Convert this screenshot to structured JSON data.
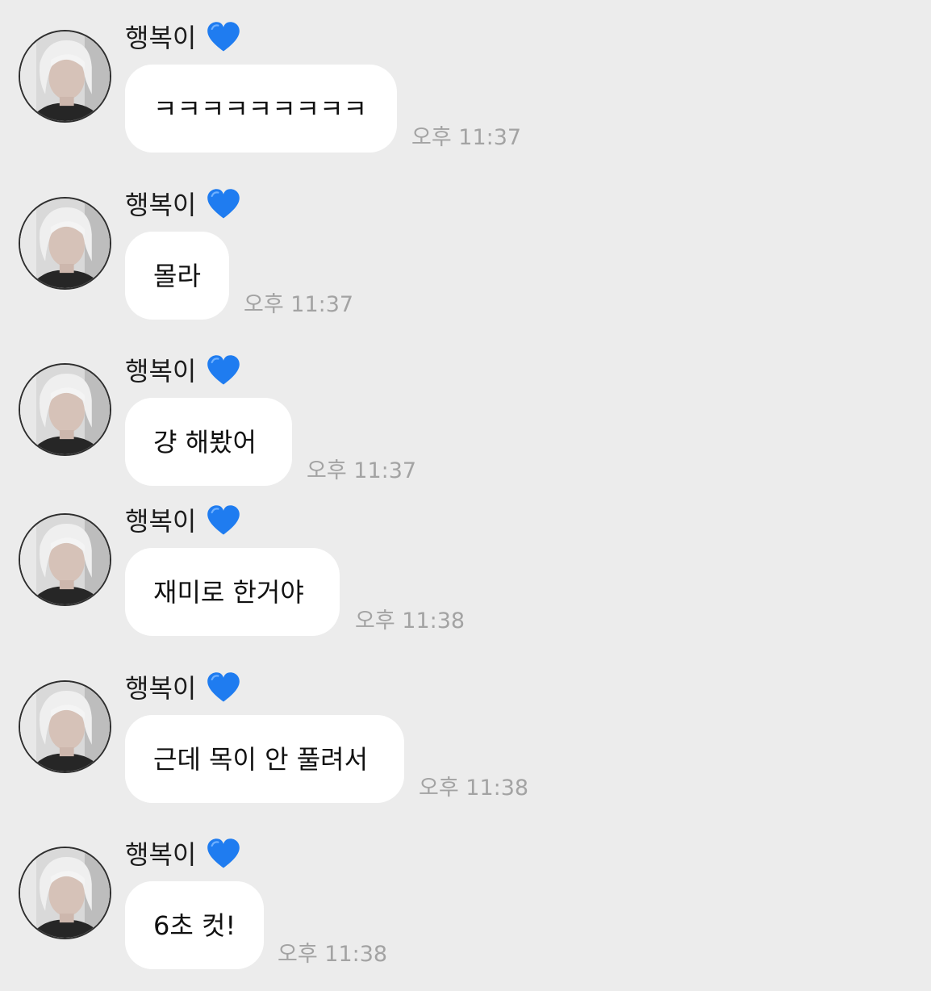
{
  "chat": {
    "messages": [
      {
        "sender": "행복이",
        "heart_icon": "blue-heart-icon",
        "text": "ㅋㅋㅋㅋㅋㅋㅋㅋㅋ",
        "time": "오후 11:37"
      },
      {
        "sender": "행복이",
        "heart_icon": "blue-heart-icon",
        "text": "몰라",
        "time": "오후 11:37"
      },
      {
        "sender": "행복이",
        "heart_icon": "blue-heart-icon",
        "text": "걍 해봤어",
        "time": "오후 11:37"
      },
      {
        "sender": "행복이",
        "heart_icon": "blue-heart-icon",
        "text": "재미로 한거야",
        "time": "오후 11:38"
      },
      {
        "sender": "행복이",
        "heart_icon": "blue-heart-icon",
        "text": "근데 목이 안 풀려서",
        "time": "오후 11:38"
      },
      {
        "sender": "행복이",
        "heart_icon": "blue-heart-icon",
        "text": "6초 컷!",
        "time": "오후 11:38"
      }
    ]
  },
  "colors": {
    "background": "#ececec",
    "bubble": "#ffffff",
    "heart": "#1f7cf0",
    "timestamp": "#a3a3a3",
    "text": "#111111"
  }
}
